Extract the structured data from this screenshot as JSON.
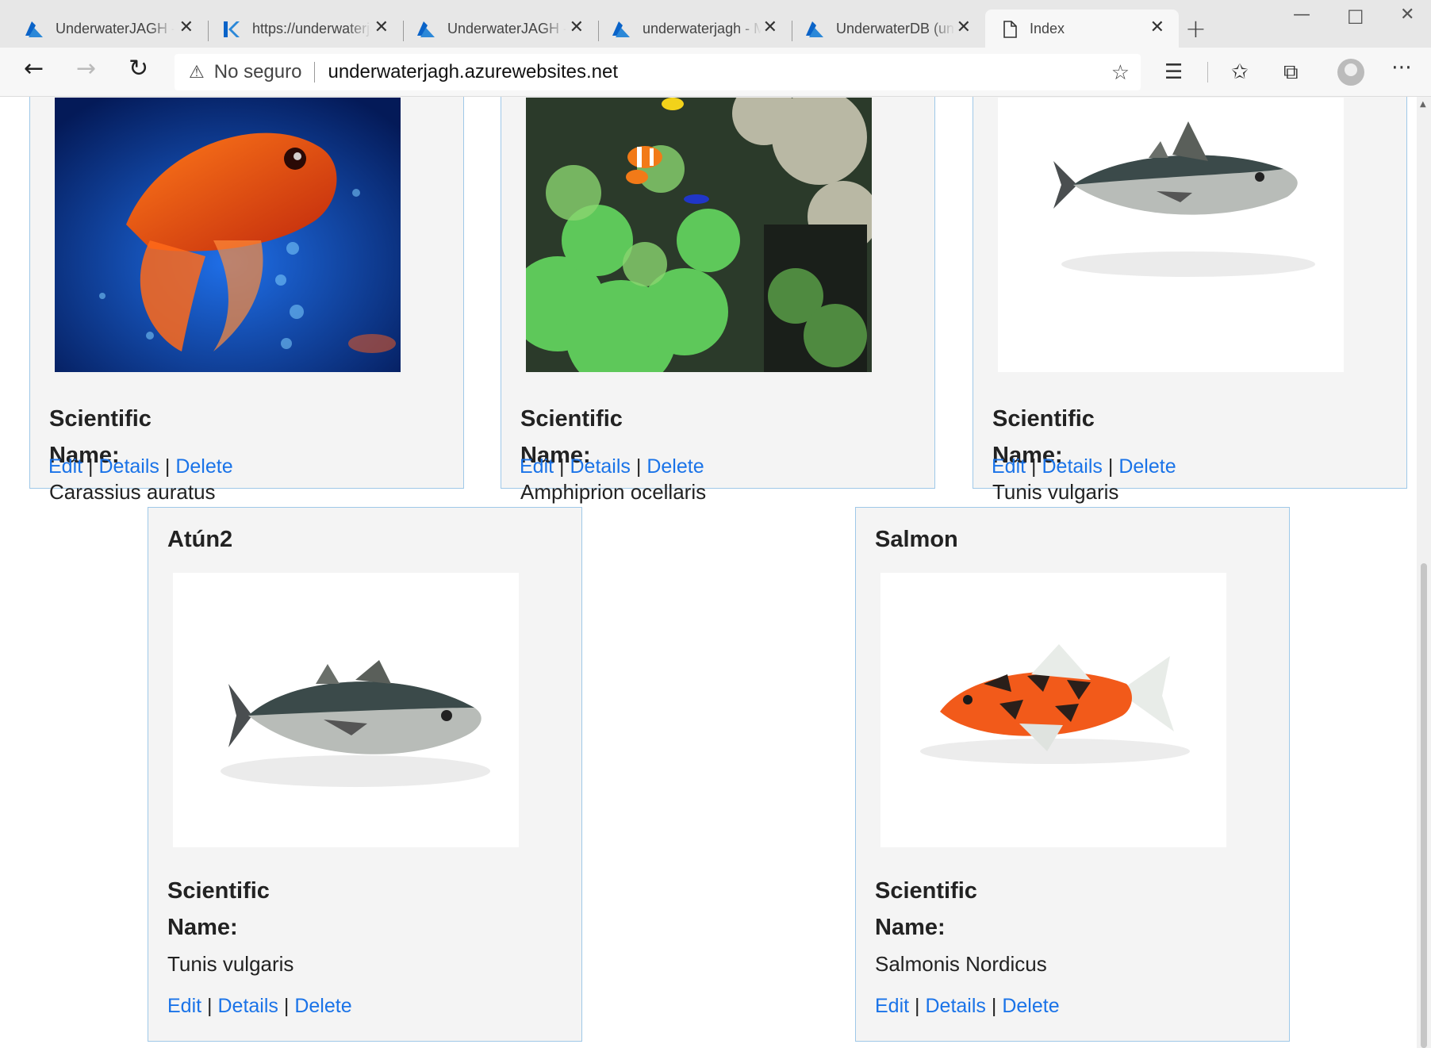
{
  "browser": {
    "tabs": [
      {
        "title": "UnderwaterJAGH - Microsoft Azure",
        "icon": "azure-icon"
      },
      {
        "title": "https://underwaterjagh.scm.azurewebsites.net",
        "icon": "kudu-icon"
      },
      {
        "title": "UnderwaterJAGH - Microsoft Azure",
        "icon": "azure-icon"
      },
      {
        "title": "underwaterjagh - Microsoft Azure",
        "icon": "azure-icon"
      },
      {
        "title": "UnderwaterDB (underwaterjagh)",
        "icon": "azure-icon"
      },
      {
        "title": "Index",
        "icon": "page-icon"
      }
    ],
    "active_tab": 5,
    "address": {
      "security_label": "No seguro",
      "url": "underwaterjagh.azurewebsites.net"
    }
  },
  "cards": [
    {
      "title": "",
      "image": "goldfish",
      "sci_label_1": "Scientific",
      "sci_label_2": "Name:",
      "sci_value": "Carassius auratus",
      "edit": "Edit",
      "details": "Details",
      "delete": "Delete",
      "sep": "|"
    },
    {
      "title": "",
      "image": "clownfish-reef",
      "sci_label_1": "Scientific",
      "sci_label_2": "Name:",
      "sci_value": "Amphiprion ocellaris",
      "edit": "Edit",
      "details": "Details",
      "delete": "Delete",
      "sep": "|"
    },
    {
      "title": "",
      "image": "tuna",
      "sci_label_1": "Scientific",
      "sci_label_2": "Name:",
      "sci_value": "Tunis vulgaris",
      "edit": "Edit",
      "details": "Details",
      "delete": "Delete",
      "sep": "|"
    },
    {
      "title": "Atún2",
      "image": "tuna",
      "sci_label_1": "Scientific",
      "sci_label_2": "Name:",
      "sci_value": "Tunis vulgaris",
      "edit": "Edit",
      "details": "Details",
      "delete": "Delete",
      "sep": "|"
    },
    {
      "title": "Salmon",
      "image": "koi",
      "sci_label_1": "Scientific",
      "sci_label_2": "Name:",
      "sci_value": "Salmonis Nordicus",
      "edit": "Edit",
      "details": "Details",
      "delete": "Delete",
      "sep": "|"
    }
  ],
  "colors": {
    "link": "#1a73e8",
    "card_border": "#9fc8e8",
    "card_bg": "#f4f4f4"
  }
}
